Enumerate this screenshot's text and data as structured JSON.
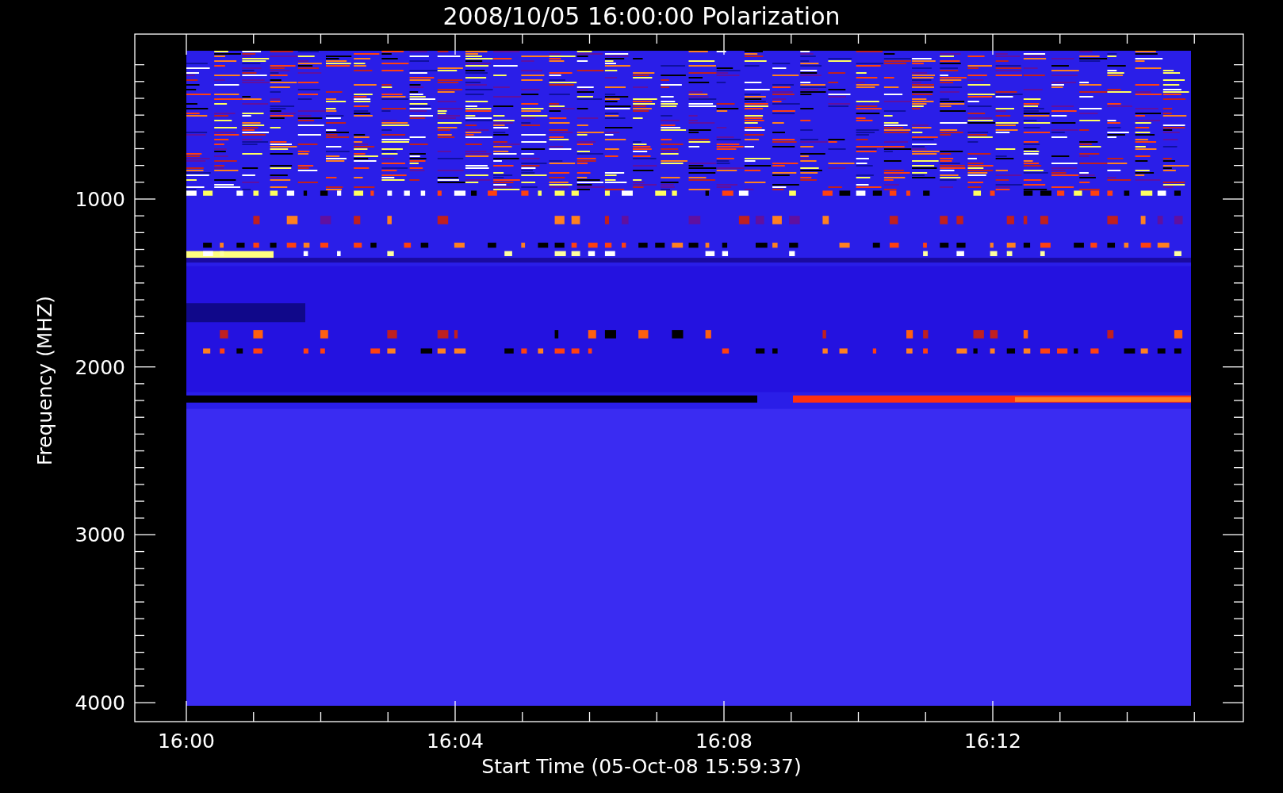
{
  "title": "2008/10/05 16:00:00 Polarization",
  "plot": {
    "ylabel": "Frequency (MHZ)",
    "xlabel": "Start Time (05-Oct-08 15:59:37)",
    "yticks": [
      "1000",
      "2000",
      "3000",
      "4000"
    ],
    "xticks": [
      "16:00",
      "16:04",
      "16:08",
      "16:12"
    ]
  }
}
